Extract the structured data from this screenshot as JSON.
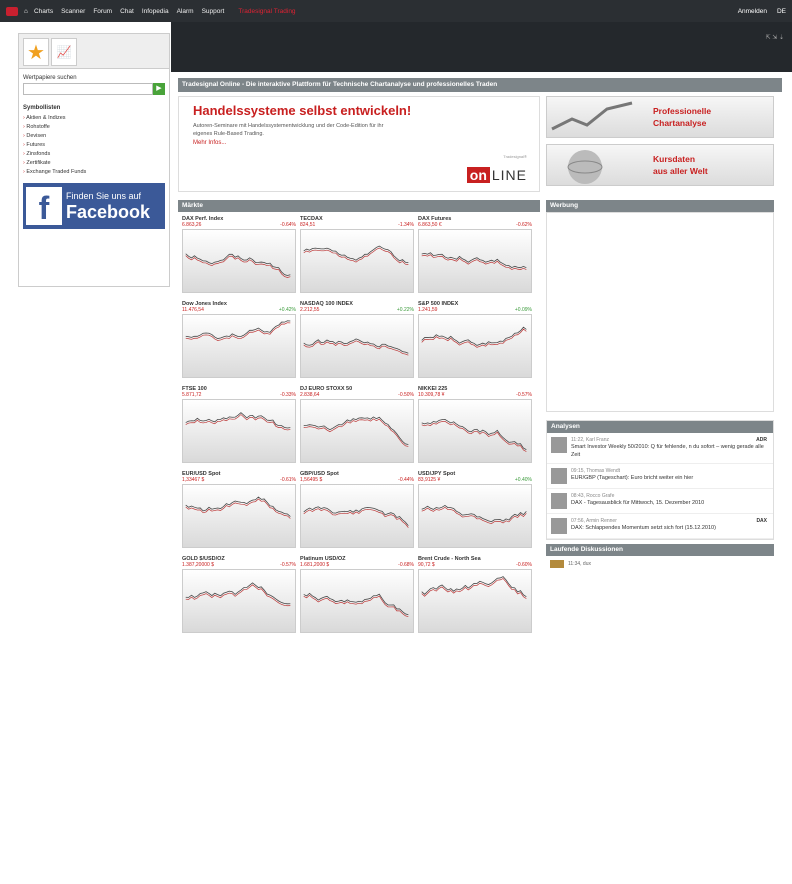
{
  "topbar": {
    "nav": [
      "Charts",
      "Scanner",
      "Forum",
      "Chat",
      "Infopedia",
      "Alarm",
      "Support"
    ],
    "ticker": "Tradesignal Trading",
    "right": [
      "Anmelden",
      "DE"
    ]
  },
  "left": {
    "search_label": "Wertpapiere suchen",
    "search_placeholder": "",
    "symbol_title": "Symbollisten",
    "symbols": [
      "Aktien & Indizes",
      "Rohstoffe",
      "Devisen",
      "Futures",
      "Zinsfonds",
      "Zertifikate",
      "Exchange Traded Funds"
    ],
    "fb_line1": "Finden Sie uns auf",
    "fb_line2": "Facebook"
  },
  "intro": "Tradesignal Online - Die interaktive Plattform für Technische Chartanalyse und professionelles Traden",
  "promo": {
    "title": "Handelssysteme selbst entwickeln!",
    "text": "Autoren-Seminare mit Handelssystementwicklung und der Code-Edition für ihr eigenes Rule-Based Trading.",
    "more": "Mehr Infos...",
    "online_small": "Tradesignal®",
    "online_on": "on",
    "online_line": "LINE",
    "btn1_l1": "Professionelle",
    "btn1_l2": "Chartanalyse",
    "btn2_l1": "Kursdaten",
    "btn2_l2": "aus aller Welt"
  },
  "markets_title": "Märkte",
  "markets": [
    {
      "name": "DAX Perf. Index",
      "v1": "6.863,26",
      "v2": "-0.64%",
      "dir": "down"
    },
    {
      "name": "TECDAX",
      "v1": "824,51",
      "v2": "-1.34%",
      "dir": "down"
    },
    {
      "name": "DAX Futures",
      "v1": "6.863,50 €",
      "v2": "-0.62%",
      "dir": "down"
    },
    {
      "name": "Dow Jones Index",
      "v1": "11.476,54",
      "v2": "+0.42%",
      "dir": "up"
    },
    {
      "name": "NASDAQ 100 INDEX",
      "v1": "2.212,55",
      "v2": "+0.22%",
      "dir": "up"
    },
    {
      "name": "S&P 500 INDEX",
      "v1": "1.241,59",
      "v2": "+0.09%",
      "dir": "up"
    },
    {
      "name": "FTSE 100",
      "v1": "5.871,72",
      "v2": "-0.33%",
      "dir": "down"
    },
    {
      "name": "DJ EURO STOXX 50",
      "v1": "2.838,64",
      "v2": "-0.50%",
      "dir": "down"
    },
    {
      "name": "NIKKEI 225",
      "v1": "10.309,78 ¥",
      "v2": "-0.57%",
      "dir": "down"
    },
    {
      "name": "EUR/USD Spot",
      "v1": "1,33467 $",
      "v2": "-0.61%",
      "dir": "down"
    },
    {
      "name": "GBP/USD Spot",
      "v1": "1,56495 $",
      "v2": "-0.44%",
      "dir": "down"
    },
    {
      "name": "USD/JPY Spot",
      "v1": "83,9125 ¥",
      "v2": "+0.40%",
      "dir": "up"
    },
    {
      "name": "GOLD $/USD/OZ",
      "v1": "1.387,20000 $",
      "v2": "-0.57%",
      "dir": "down"
    },
    {
      "name": "Platinum USD/OZ",
      "v1": "1.681,2000 $",
      "v2": "-0.68%",
      "dir": "down"
    },
    {
      "name": "Brent Crude - North Sea",
      "v1": "90,72 $",
      "v2": "-0.60%",
      "dir": "down"
    }
  ],
  "werbung_title": "Werbung",
  "analysen_title": "Analysen",
  "analysen": [
    {
      "meta": "11:22, Karl Franz",
      "txt": "Smart Investor Weekly 50/2010: Q für fehlende, n du sofort – wenig gerade alle Zeit",
      "tag": "ADR"
    },
    {
      "meta": "09:15, Thomas Wendt",
      "txt": "EUR/GBP (Tageschart): Euro bricht weiter ein hier",
      "tag": ""
    },
    {
      "meta": "08:43, Rocco Grafe",
      "txt": "DAX - Tagesausblick für Mittwoch, 15. Dezember 2010",
      "tag": ""
    },
    {
      "meta": "07:56, Armin Renner",
      "txt": "DAX: Schlappendes Momentum setzt sich fort (15.12.2010)",
      "tag": "DAX"
    }
  ],
  "laufende_title": "Laufende Diskussionen",
  "laufende": [
    {
      "meta": "11:34, dux"
    }
  ]
}
